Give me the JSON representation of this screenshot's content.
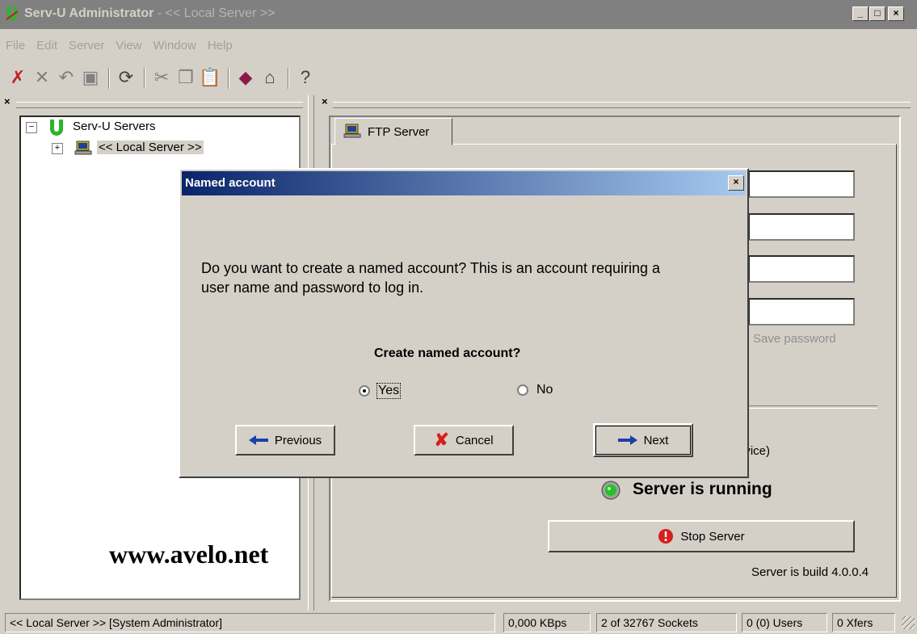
{
  "window": {
    "title": "Serv-U Administrator - << Local Server >>",
    "title_app": "Serv-U Administrator",
    "title_rest": " - << Local Server >>",
    "buttons": [
      "_",
      "□",
      "×"
    ]
  },
  "menu": [
    "File",
    "Edit",
    "Server",
    "View",
    "Window",
    "Help"
  ],
  "toolbar": [
    "cut-red-x-icon",
    "delete-icon",
    "undo-icon",
    "save-icon",
    "refresh-icon",
    "cut-icon",
    "copy-icon",
    "paste-icon",
    "book-icon",
    "home-icon",
    "help-icon"
  ],
  "tree": {
    "root": "Serv-U Servers",
    "child": "<< Local Server >>"
  },
  "tab": {
    "label": "FTP Server"
  },
  "right": {
    "save_password": "Save password",
    "service_text": "ervice)",
    "status": "Server is running",
    "stop_button": "Stop Server",
    "build": "Server is build 4.0.0.4"
  },
  "dialog": {
    "title": "Named account",
    "message": "Do you want to create a named account? This is an account requiring a user name and password to log in.",
    "question": "Create named account?",
    "yes": "Yes",
    "no": "No",
    "selected": "Yes",
    "previous": "Previous",
    "cancel": "Cancel",
    "next": "Next"
  },
  "watermark": "www.avelo.net",
  "status_bar": {
    "server": "<< Local Server >>   [System Administrator]",
    "speed": "0,000 KBps",
    "sockets": "2 of 32767 Sockets",
    "users": "0 (0) Users",
    "xfers": "0 Xfers"
  },
  "colors": {
    "titlebar_inactive": "#808080",
    "dialog_title_start": "#0a246a",
    "dialog_title_end": "#a6caf0",
    "running": "#22c322"
  }
}
